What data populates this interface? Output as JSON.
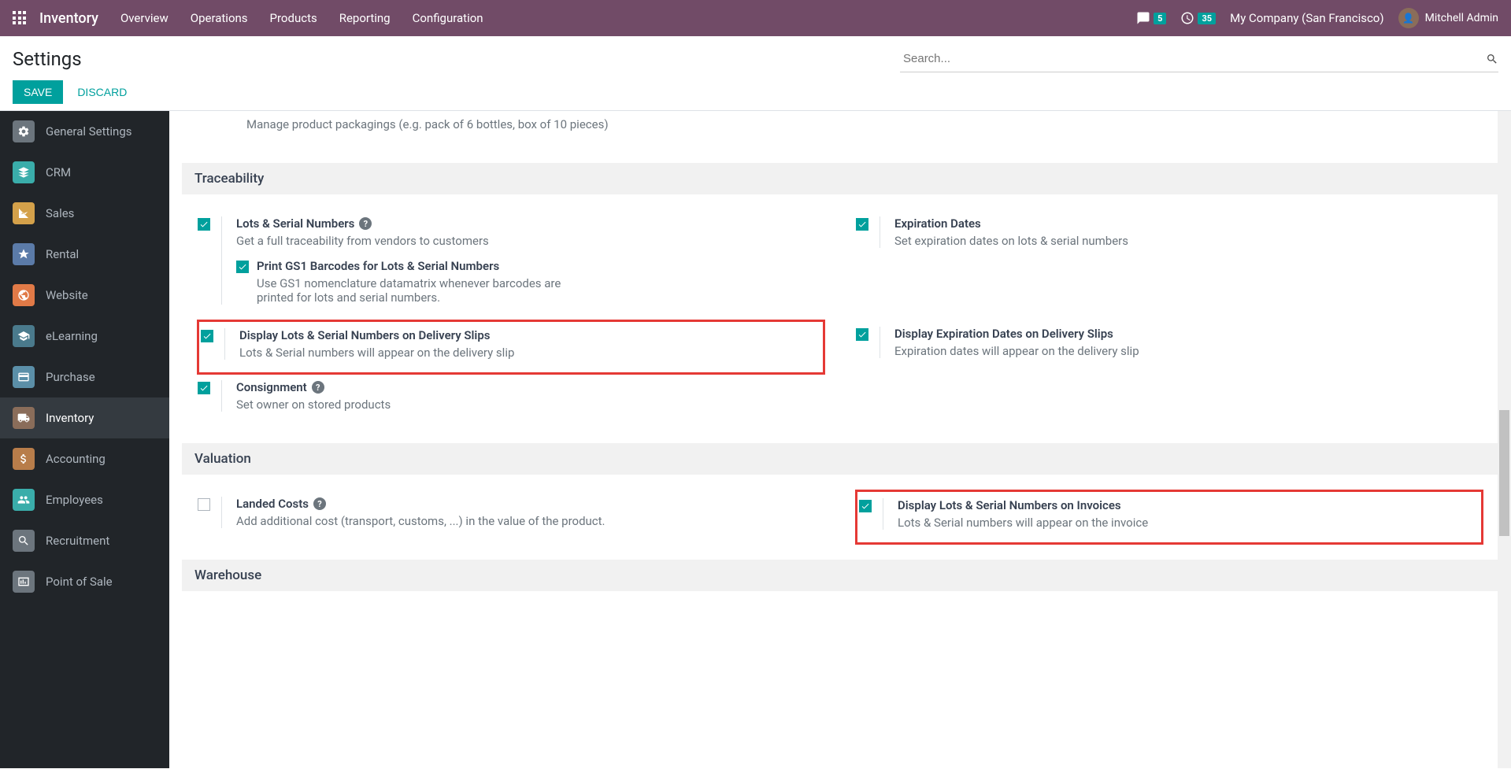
{
  "navbar": {
    "brand": "Inventory",
    "menu": [
      "Overview",
      "Operations",
      "Products",
      "Reporting",
      "Configuration"
    ],
    "messages_count": "5",
    "activities_count": "35",
    "company": "My Company (San Francisco)",
    "user": "Mitchell Admin"
  },
  "control_panel": {
    "title": "Settings",
    "search_placeholder": "Search...",
    "save": "SAVE",
    "discard": "DISCARD"
  },
  "sidebar": {
    "items": [
      {
        "label": "General Settings",
        "color": "#6c757d"
      },
      {
        "label": "CRM",
        "color": "#3aadaa"
      },
      {
        "label": "Sales",
        "color": "#d4a14a"
      },
      {
        "label": "Rental",
        "color": "#5b7ba8"
      },
      {
        "label": "Website",
        "color": "#e17a47"
      },
      {
        "label": "eLearning",
        "color": "#4a7a8c"
      },
      {
        "label": "Purchase",
        "color": "#5b8fa8"
      },
      {
        "label": "Inventory",
        "color": "#8a6d5a"
      },
      {
        "label": "Accounting",
        "color": "#b87d4a"
      },
      {
        "label": "Employees",
        "color": "#3aadaa"
      },
      {
        "label": "Recruitment",
        "color": "#6c757d"
      },
      {
        "label": "Point of Sale",
        "color": "#6c757d"
      }
    ],
    "active_index": 7
  },
  "content": {
    "partial_top": "Manage product packagings (e.g. pack of 6 bottles, box of 10 pieces)",
    "sections": {
      "traceability": {
        "header": "Traceability",
        "lots": {
          "title": "Lots & Serial Numbers",
          "desc": "Get a full traceability from vendors to customers",
          "sub_title": "Print GS1 Barcodes for Lots & Serial Numbers",
          "sub_desc": "Use GS1 nomenclature datamatrix whenever barcodes are printed for lots and serial numbers."
        },
        "expiration": {
          "title": "Expiration Dates",
          "desc": "Set expiration dates on lots & serial numbers"
        },
        "display_delivery": {
          "title": "Display Lots & Serial Numbers on Delivery Slips",
          "desc": "Lots & Serial numbers will appear on the delivery slip"
        },
        "display_exp_delivery": {
          "title": "Display Expiration Dates on Delivery Slips",
          "desc": "Expiration dates will appear on the delivery slip"
        },
        "consignment": {
          "title": "Consignment",
          "desc": "Set owner on stored products"
        }
      },
      "valuation": {
        "header": "Valuation",
        "landed": {
          "title": "Landed Costs",
          "desc": "Add additional cost (transport, customs, ...) in the value of the product."
        },
        "display_invoice": {
          "title": "Display Lots & Serial Numbers on Invoices",
          "desc": "Lots & Serial numbers will appear on the invoice"
        }
      },
      "warehouse": {
        "header": "Warehouse"
      }
    }
  }
}
